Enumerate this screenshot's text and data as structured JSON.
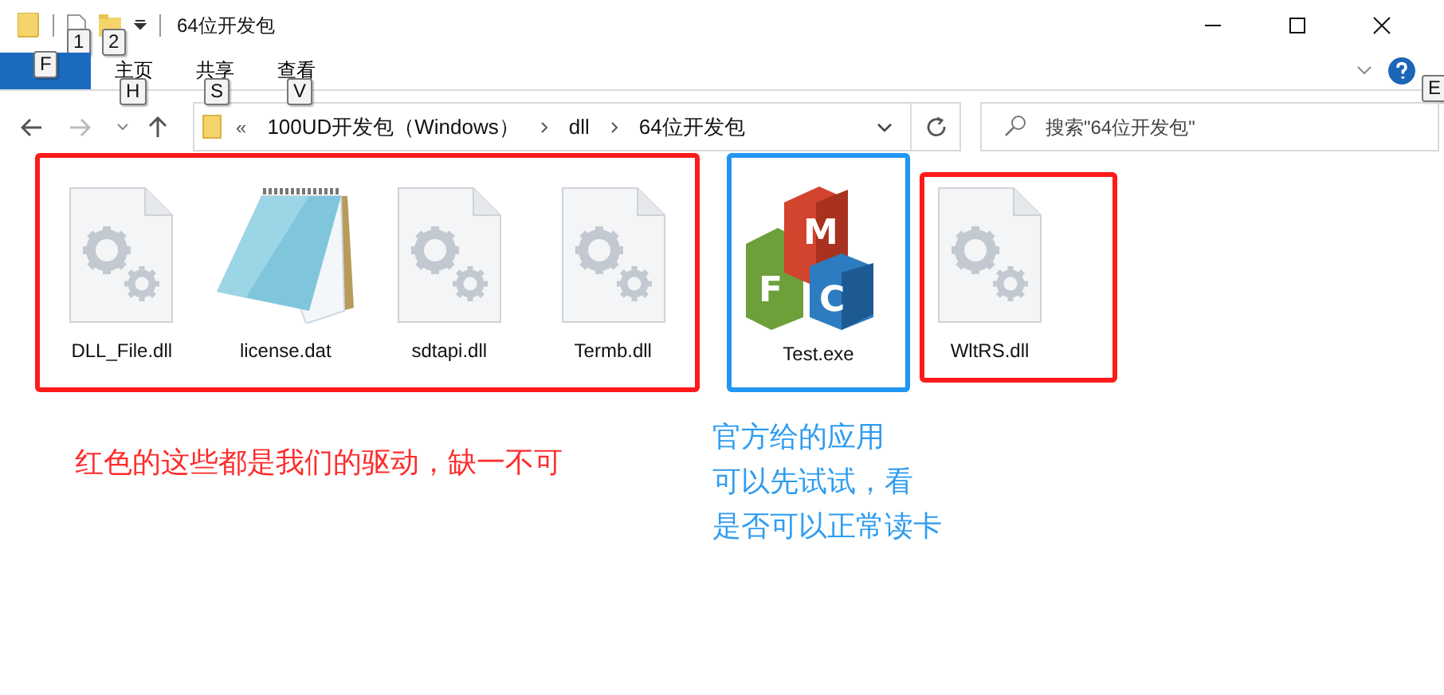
{
  "window": {
    "title": "64位开发包",
    "quick_access_keytips": [
      "1",
      "2"
    ]
  },
  "ribbon": {
    "tabs": [
      {
        "keytip": "F",
        "kind": "file"
      },
      {
        "label": "主页",
        "keytip": "H",
        "kind": "tab"
      },
      {
        "label": "共享",
        "keytip": "S",
        "kind": "tab"
      },
      {
        "label": "查看",
        "keytip": "V",
        "kind": "tab"
      }
    ],
    "help_keytip": "E"
  },
  "address_bar": {
    "overflow": "«",
    "path": [
      "100UD开发包（Windows）",
      "dll",
      "64位开发包"
    ]
  },
  "search": {
    "placeholder": "搜索\"64位开发包\""
  },
  "groups": [
    {
      "color": "#ff1a1a",
      "files": [
        {
          "name": "DLL_File.dll",
          "kind": "dll"
        },
        {
          "name": "license.dat",
          "kind": "notepad"
        },
        {
          "name": "sdtapi.dll",
          "kind": "dll"
        },
        {
          "name": "Termb.dll",
          "kind": "dll"
        }
      ]
    },
    {
      "color": "#2196f3",
      "files": [
        {
          "name": "Test.exe",
          "kind": "mfc",
          "icon_letters": [
            "M",
            "F",
            "C"
          ]
        }
      ]
    },
    {
      "color": "#ff1a1a",
      "files": [
        {
          "name": "WltRS.dll",
          "kind": "dll"
        }
      ]
    }
  ],
  "notes": [
    {
      "lines": [
        "红色的这些都是我们的驱动，缺一不可"
      ],
      "color": "#ff2b2b"
    },
    {
      "lines": [
        "官方给的应用",
        "可以先试试，看",
        "是否可以正常读卡"
      ],
      "color": "#2f9cf0"
    }
  ]
}
